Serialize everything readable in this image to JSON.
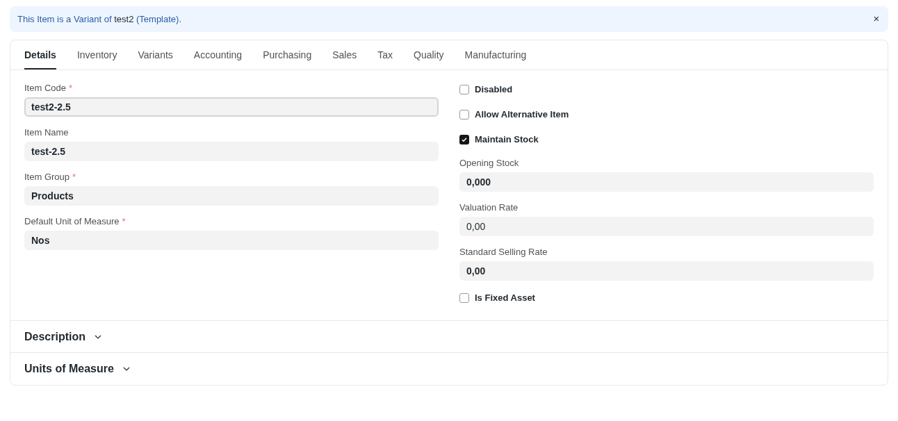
{
  "banner": {
    "text_before": "This Item is a Variant of",
    "link": "test2",
    "text_after": "(Template).",
    "close": "×"
  },
  "tabs": [
    {
      "label": "Details",
      "selected": true
    },
    {
      "label": "Inventory",
      "selected": false
    },
    {
      "label": "Variants",
      "selected": false
    },
    {
      "label": "Accounting",
      "selected": false
    },
    {
      "label": "Purchasing",
      "selected": false
    },
    {
      "label": "Sales",
      "selected": false
    },
    {
      "label": "Tax",
      "selected": false
    },
    {
      "label": "Quality",
      "selected": false
    },
    {
      "label": "Manufacturing",
      "selected": false
    }
  ],
  "left_column": [
    {
      "kind": "field",
      "label": "Item Code",
      "required_mark": "*",
      "value": "test2-2.5",
      "focused": true,
      "bold": true
    },
    {
      "kind": "field",
      "label": "Item Name",
      "value": "test-2.5",
      "focused": false,
      "bold": true
    },
    {
      "kind": "field",
      "label": "Item Group",
      "required_mark": "*",
      "value": "Products",
      "focused": false,
      "bold": true
    },
    {
      "kind": "field",
      "label": "Default Unit of Measure",
      "required_mark": "*",
      "value": "Nos",
      "focused": false,
      "bold": true
    }
  ],
  "right_column": [
    {
      "kind": "checkbox",
      "label": "Disabled",
      "checked": false
    },
    {
      "kind": "checkbox",
      "label": "Allow Alternative Item",
      "checked": false
    },
    {
      "kind": "checkbox",
      "label": "Maintain Stock",
      "checked": true
    },
    {
      "kind": "field",
      "label": "Opening Stock",
      "value": "0,000",
      "focused": false,
      "bold": true
    },
    {
      "kind": "field",
      "label": "Valuation Rate",
      "value": "0,00",
      "focused": false,
      "bold": false
    },
    {
      "kind": "field",
      "label": "Standard Selling Rate",
      "value": "0,00",
      "focused": false,
      "bold": true
    },
    {
      "kind": "checkbox",
      "label": "Is Fixed Asset",
      "checked": false
    }
  ],
  "sections": [
    {
      "title": "Description",
      "expanded": false
    },
    {
      "title": "Units of Measure",
      "expanded": false
    }
  ]
}
